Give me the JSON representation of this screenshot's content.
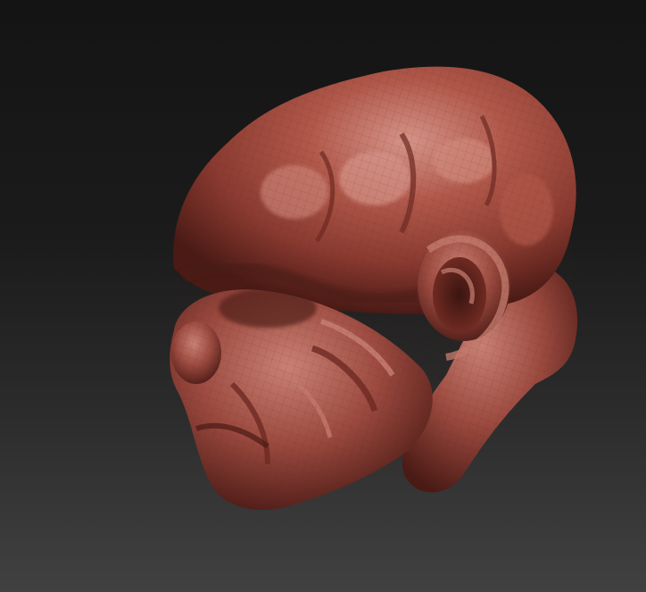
{
  "viewport": {
    "background_top": "#141414",
    "background_bottom": "#414141"
  },
  "model": {
    "material_color": "#9c4a3f",
    "highlight_color": "#d08a7c",
    "shadow_color": "#3a1410"
  }
}
